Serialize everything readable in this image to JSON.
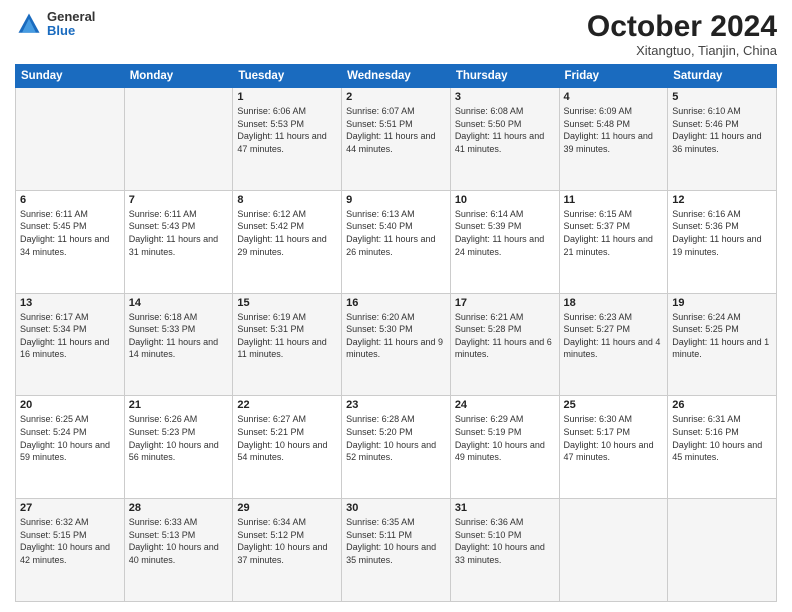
{
  "header": {
    "logo_general": "General",
    "logo_blue": "Blue",
    "title": "October 2024",
    "location": "Xitangtuo, Tianjin, China"
  },
  "weekdays": [
    "Sunday",
    "Monday",
    "Tuesday",
    "Wednesday",
    "Thursday",
    "Friday",
    "Saturday"
  ],
  "weeks": [
    [
      {
        "day": "",
        "detail": ""
      },
      {
        "day": "",
        "detail": ""
      },
      {
        "day": "1",
        "detail": "Sunrise: 6:06 AM\nSunset: 5:53 PM\nDaylight: 11 hours and 47 minutes."
      },
      {
        "day": "2",
        "detail": "Sunrise: 6:07 AM\nSunset: 5:51 PM\nDaylight: 11 hours and 44 minutes."
      },
      {
        "day": "3",
        "detail": "Sunrise: 6:08 AM\nSunset: 5:50 PM\nDaylight: 11 hours and 41 minutes."
      },
      {
        "day": "4",
        "detail": "Sunrise: 6:09 AM\nSunset: 5:48 PM\nDaylight: 11 hours and 39 minutes."
      },
      {
        "day": "5",
        "detail": "Sunrise: 6:10 AM\nSunset: 5:46 PM\nDaylight: 11 hours and 36 minutes."
      }
    ],
    [
      {
        "day": "6",
        "detail": "Sunrise: 6:11 AM\nSunset: 5:45 PM\nDaylight: 11 hours and 34 minutes."
      },
      {
        "day": "7",
        "detail": "Sunrise: 6:11 AM\nSunset: 5:43 PM\nDaylight: 11 hours and 31 minutes."
      },
      {
        "day": "8",
        "detail": "Sunrise: 6:12 AM\nSunset: 5:42 PM\nDaylight: 11 hours and 29 minutes."
      },
      {
        "day": "9",
        "detail": "Sunrise: 6:13 AM\nSunset: 5:40 PM\nDaylight: 11 hours and 26 minutes."
      },
      {
        "day": "10",
        "detail": "Sunrise: 6:14 AM\nSunset: 5:39 PM\nDaylight: 11 hours and 24 minutes."
      },
      {
        "day": "11",
        "detail": "Sunrise: 6:15 AM\nSunset: 5:37 PM\nDaylight: 11 hours and 21 minutes."
      },
      {
        "day": "12",
        "detail": "Sunrise: 6:16 AM\nSunset: 5:36 PM\nDaylight: 11 hours and 19 minutes."
      }
    ],
    [
      {
        "day": "13",
        "detail": "Sunrise: 6:17 AM\nSunset: 5:34 PM\nDaylight: 11 hours and 16 minutes."
      },
      {
        "day": "14",
        "detail": "Sunrise: 6:18 AM\nSunset: 5:33 PM\nDaylight: 11 hours and 14 minutes."
      },
      {
        "day": "15",
        "detail": "Sunrise: 6:19 AM\nSunset: 5:31 PM\nDaylight: 11 hours and 11 minutes."
      },
      {
        "day": "16",
        "detail": "Sunrise: 6:20 AM\nSunset: 5:30 PM\nDaylight: 11 hours and 9 minutes."
      },
      {
        "day": "17",
        "detail": "Sunrise: 6:21 AM\nSunset: 5:28 PM\nDaylight: 11 hours and 6 minutes."
      },
      {
        "day": "18",
        "detail": "Sunrise: 6:23 AM\nSunset: 5:27 PM\nDaylight: 11 hours and 4 minutes."
      },
      {
        "day": "19",
        "detail": "Sunrise: 6:24 AM\nSunset: 5:25 PM\nDaylight: 11 hours and 1 minute."
      }
    ],
    [
      {
        "day": "20",
        "detail": "Sunrise: 6:25 AM\nSunset: 5:24 PM\nDaylight: 10 hours and 59 minutes."
      },
      {
        "day": "21",
        "detail": "Sunrise: 6:26 AM\nSunset: 5:23 PM\nDaylight: 10 hours and 56 minutes."
      },
      {
        "day": "22",
        "detail": "Sunrise: 6:27 AM\nSunset: 5:21 PM\nDaylight: 10 hours and 54 minutes."
      },
      {
        "day": "23",
        "detail": "Sunrise: 6:28 AM\nSunset: 5:20 PM\nDaylight: 10 hours and 52 minutes."
      },
      {
        "day": "24",
        "detail": "Sunrise: 6:29 AM\nSunset: 5:19 PM\nDaylight: 10 hours and 49 minutes."
      },
      {
        "day": "25",
        "detail": "Sunrise: 6:30 AM\nSunset: 5:17 PM\nDaylight: 10 hours and 47 minutes."
      },
      {
        "day": "26",
        "detail": "Sunrise: 6:31 AM\nSunset: 5:16 PM\nDaylight: 10 hours and 45 minutes."
      }
    ],
    [
      {
        "day": "27",
        "detail": "Sunrise: 6:32 AM\nSunset: 5:15 PM\nDaylight: 10 hours and 42 minutes."
      },
      {
        "day": "28",
        "detail": "Sunrise: 6:33 AM\nSunset: 5:13 PM\nDaylight: 10 hours and 40 minutes."
      },
      {
        "day": "29",
        "detail": "Sunrise: 6:34 AM\nSunset: 5:12 PM\nDaylight: 10 hours and 37 minutes."
      },
      {
        "day": "30",
        "detail": "Sunrise: 6:35 AM\nSunset: 5:11 PM\nDaylight: 10 hours and 35 minutes."
      },
      {
        "day": "31",
        "detail": "Sunrise: 6:36 AM\nSunset: 5:10 PM\nDaylight: 10 hours and 33 minutes."
      },
      {
        "day": "",
        "detail": ""
      },
      {
        "day": "",
        "detail": ""
      }
    ]
  ]
}
